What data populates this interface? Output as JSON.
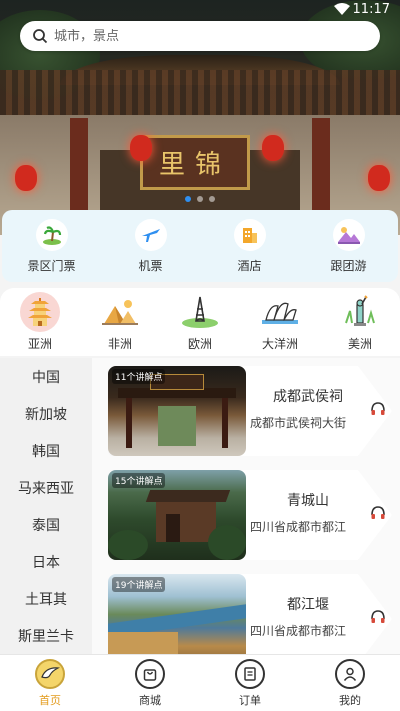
{
  "status_bar": {
    "time": "11:17"
  },
  "hero": {
    "plaque_text": "里锦"
  },
  "search": {
    "placeholder": "城市，景点"
  },
  "categories": [
    {
      "label": "景区门票",
      "icon": "palm-island-icon"
    },
    {
      "label": "机票",
      "icon": "airplane-icon"
    },
    {
      "label": "酒店",
      "icon": "hotel-building-icon"
    },
    {
      "label": "跟团游",
      "icon": "mountain-tour-icon"
    }
  ],
  "continents": [
    {
      "label": "亚洲",
      "icon": "pagoda-icon",
      "selected": true
    },
    {
      "label": "非洲",
      "icon": "pyramid-icon",
      "selected": false
    },
    {
      "label": "欧洲",
      "icon": "eiffel-tower-icon",
      "selected": false
    },
    {
      "label": "大洋洲",
      "icon": "opera-house-icon",
      "selected": false
    },
    {
      "label": "美洲",
      "icon": "statue-of-liberty-icon",
      "selected": false
    }
  ],
  "countries": [
    "中国",
    "新加坡",
    "韩国",
    "马来西亚",
    "泰国",
    "日本",
    "土耳其",
    "斯里兰卡"
  ],
  "spots": [
    {
      "badge": "11个讲解点",
      "name": "成都武侯祠",
      "address": "成都市武侯祠大街"
    },
    {
      "badge": "15个讲解点",
      "name": "青城山",
      "address": "四川省成都市都江"
    },
    {
      "badge": "19个讲解点",
      "name": "都江堰",
      "address": "四川省成都市都江"
    }
  ],
  "nav": [
    {
      "label": "首页",
      "icon": "home-bird-icon",
      "active": true
    },
    {
      "label": "商城",
      "icon": "shopping-bag-icon",
      "active": false
    },
    {
      "label": "订单",
      "icon": "order-list-icon",
      "active": false
    },
    {
      "label": "我的",
      "icon": "user-profile-icon",
      "active": false
    }
  ],
  "colors": {
    "accent_blue": "#2f8ff0",
    "active_orange": "#e39c1f",
    "category_bg": "#eaf6fb"
  }
}
